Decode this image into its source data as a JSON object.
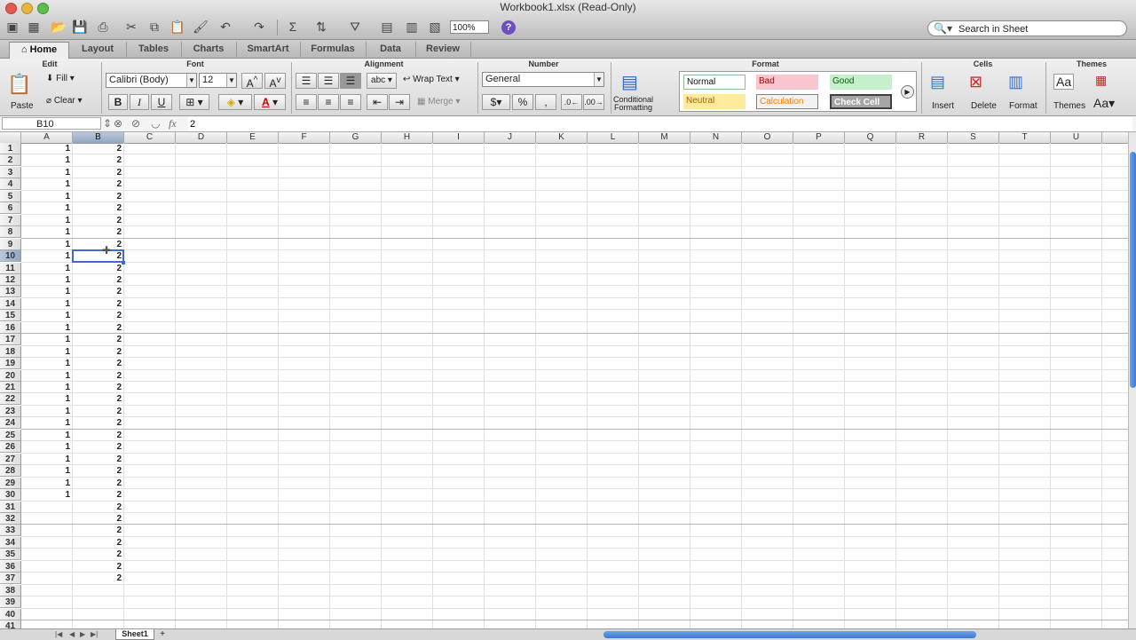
{
  "window": {
    "title": "Workbook1.xlsx  (Read-Only)"
  },
  "toolbar": {
    "zoom": "100%",
    "help": "?",
    "search_placeholder": "Search in Sheet"
  },
  "ribbon_tabs": [
    "Home",
    "Layout",
    "Tables",
    "Charts",
    "SmartArt",
    "Formulas",
    "Data",
    "Review"
  ],
  "ribbon": {
    "groups": {
      "edit": "Edit",
      "font": "Font",
      "alignment": "Alignment",
      "number": "Number",
      "format": "Format",
      "cells": "Cells",
      "themes": "Themes"
    },
    "paste": "Paste",
    "fill": "Fill",
    "clear": "Clear",
    "font_name": "Calibri (Body)",
    "font_size": "12",
    "bold": "B",
    "italic": "I",
    "underline": "U",
    "wrap_text": "Wrap Text",
    "merge": "Merge",
    "number_format": "General",
    "conditional": "Conditional",
    "formatting": "Formatting",
    "styles": [
      "Normal",
      "Bad",
      "Good",
      "Neutral",
      "Calculation",
      "Check Cell"
    ],
    "insert": "Insert",
    "delete": "Delete",
    "format": "Format",
    "themes": "Themes",
    "font_aa": "Aa"
  },
  "formula_bar": {
    "name_box": "B10",
    "fx": "fx",
    "value": "2"
  },
  "sheet": {
    "columns": [
      "A",
      "B",
      "C",
      "D",
      "E",
      "F",
      "G",
      "H",
      "I",
      "J",
      "K",
      "L",
      "M",
      "N",
      "O",
      "P",
      "Q",
      "R",
      "S",
      "T",
      "U"
    ],
    "selected_col": "B",
    "selected_row": 10,
    "col_a_value": "1",
    "col_a_rows": 30,
    "col_b_value": "2",
    "col_b_rows": 37,
    "visible_rows": 41,
    "tab_name": "Sheet1",
    "add_tab": "+"
  }
}
